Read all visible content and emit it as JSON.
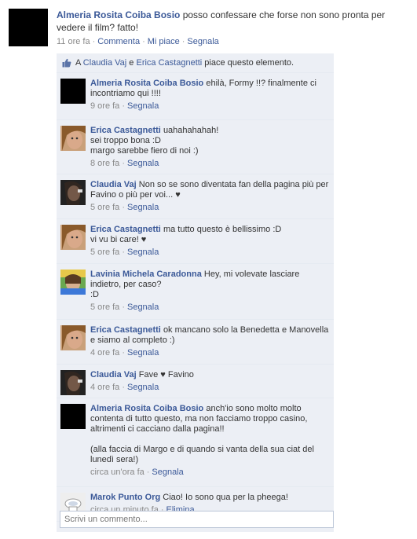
{
  "post": {
    "author": "Almeria Rosita Coiba Bosio",
    "text": " posso confessare che forse non sono pronta per vedere il film? fatto!",
    "time": "11 ore fa",
    "actions": [
      "Commenta",
      "Mi piace",
      "Segnala"
    ]
  },
  "likes": {
    "prefix": "A ",
    "person1": "Claudia Vaj",
    "joiner": " e ",
    "person2": "Erica Castagnetti",
    "suffix": " piace questo elemento."
  },
  "comments": [
    {
      "author": "Almeria Rosita Coiba Bosio",
      "text": "ehilà, Formy !!? finalmente ci incontriamo qui !!!!",
      "time": "9 ore fa",
      "action": "Segnala",
      "avatar": "black"
    },
    {
      "author": "Erica Castagnetti",
      "text": "uahahahahah!\nsei troppo bona :D\nmargo sarebbe fiero di noi :)",
      "time": "8 ore fa",
      "action": "Segnala",
      "avatar": "erica"
    },
    {
      "author": "Claudia Vaj",
      "text": "Non so se sono diventata fan della pagina più per Favino o più per voi... ♥",
      "time": "5 ore fa",
      "action": "Segnala",
      "avatar": "claudia"
    },
    {
      "author": "Erica Castagnetti",
      "text": "ma tutto questo è bellissimo :D\nvi vu bi care! ♥",
      "time": "5 ore fa",
      "action": "Segnala",
      "avatar": "erica"
    },
    {
      "author": "Lavinia Michela Caradonna",
      "text": "Hey, mi volevate lasciare indietro, per caso?\n:D",
      "time": "5 ore fa",
      "action": "Segnala",
      "avatar": "lavinia"
    },
    {
      "author": "Erica Castagnetti",
      "text": "ok mancano solo la Benedetta e Manovella e siamo al completo :)",
      "time": "4 ore fa",
      "action": "Segnala",
      "avatar": "erica"
    },
    {
      "author": "Claudia Vaj",
      "text": "Fave ♥ Favino",
      "time": "4 ore fa",
      "action": "Segnala",
      "avatar": "claudia"
    },
    {
      "author": "Almeria Rosita Coiba Bosio",
      "text": "anch'io sono molto molto contenta di tutto questo, ma non facciamo troppo casino, altrimenti ci cacciano dalla pagina!!\n\n(alla faccia di Margo e di quando si vanta della sua ciat del lunedì sera!)",
      "time": "circa un'ora fa",
      "action": "Segnala",
      "avatar": "black"
    },
    {
      "author": "Marok Punto Org",
      "text": "Ciao! Io sono qua per la pheega!",
      "time": "circa un minuto fa",
      "action": "Elimina",
      "avatar": "marok"
    }
  ],
  "write_placeholder": "Scrivi un commento..."
}
